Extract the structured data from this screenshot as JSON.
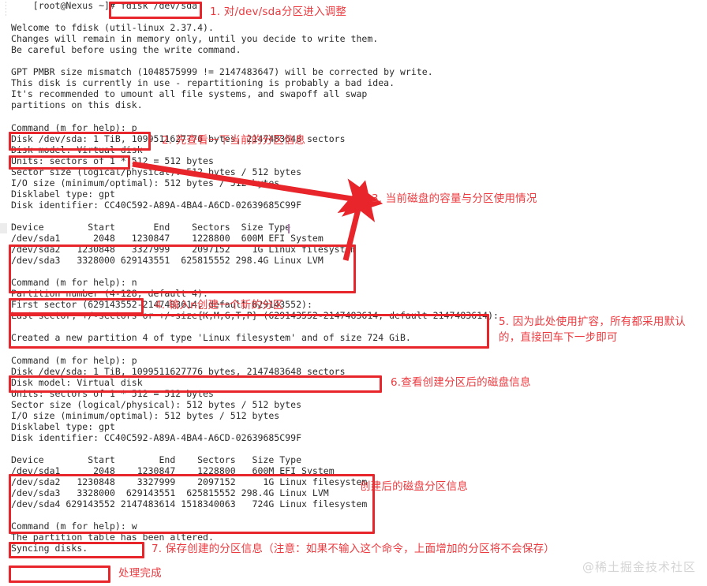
{
  "terminal": {
    "lines": [
      "    [root@Nexus ~]# fdisk /dev/sda",
      "",
      "Welcome to fdisk (util-linux 2.37.4).",
      "Changes will remain in memory only, until you decide to write them.",
      "Be careful before using the write command.",
      "",
      "GPT PMBR size mismatch (1048575999 != 2147483647) will be corrected by write.",
      "This disk is currently in use - repartitioning is probably a bad idea.",
      "It's recommended to umount all file systems, and swapoff all swap",
      "partitions on this disk.",
      "",
      "Command (m for help): p",
      "Disk /dev/sda: 1 TiB, 1099511627776 bytes, 2147483648 sectors",
      "Disk model: Virtual disk",
      "Units: sectors of 1 * 512 = 512 bytes",
      "Sector size (logical/physical): 512 bytes / 512 bytes",
      "I/O size (minimum/optimal): 512 bytes / 512 bytes",
      "Disklabel type: gpt",
      "Disk identifier: CC40C592-A89A-4BA4-A6CD-02639685C99F",
      "",
      "Device        Start       End    Sectors  Size Type",
      "/dev/sda1      2048   1230847    1228800  600M EFI System",
      "/dev/sda2   1230848   3327999    2097152    1G Linux filesystem",
      "/dev/sda3   3328000 629143551  625815552 298.4G Linux LVM",
      "",
      "Command (m for help): n",
      "Partition number (4-128, default 4):",
      "First sector (629143552-2147483614, default 629143552):",
      "Last sector, +/-sectors or +/-size{K,M,G,T,P} (629143552-2147483614, default 2147483614):",
      "",
      "Created a new partition 4 of type 'Linux filesystem' and of size 724 GiB.",
      "",
      "Command (m for help): p",
      "Disk /dev/sda: 1 TiB, 1099511627776 bytes, 2147483648 sectors",
      "Disk model: Virtual disk",
      "Units: sectors of 1 * 512 = 512 bytes",
      "Sector size (logical/physical): 512 bytes / 512 bytes",
      "I/O size (minimum/optimal): 512 bytes / 512 bytes",
      "Disklabel type: gpt",
      "Disk identifier: CC40C592-A89A-4BA4-A6CD-02639685C99F",
      "",
      "Device        Start        End    Sectors   Size Type",
      "/dev/sda1      2048    1230847    1228800   600M EFI System",
      "/dev/sda2   1230848    3327999    2097152     1G Linux filesystem",
      "/dev/sda3   3328000  629143551  625815552 298.4G Linux LVM",
      "/dev/sda4 629143552 2147483614 1518340063   724G Linux filesystem",
      "",
      "Command (m for help): w",
      "The partition table has been altered.",
      "Syncing disks."
    ]
  },
  "partition_table_first": {
    "headers": [
      "Device",
      "Start",
      "End",
      "Sectors",
      "Size",
      "Type"
    ],
    "rows": [
      [
        "/dev/sda1",
        "2048",
        "1230847",
        "1228800",
        "600M",
        "EFI System"
      ],
      [
        "/dev/sda2",
        "1230848",
        "3327999",
        "2097152",
        "1G",
        "Linux filesystem"
      ],
      [
        "/dev/sda3",
        "3328000",
        "629143551",
        "625815552",
        "298.4G",
        "Linux LVM"
      ]
    ]
  },
  "partition_table_second": {
    "headers": [
      "Device",
      "Start",
      "End",
      "Sectors",
      "Size",
      "Type"
    ],
    "rows": [
      [
        "/dev/sda1",
        "2048",
        "1230847",
        "1228800",
        "600M",
        "EFI System"
      ],
      [
        "/dev/sda2",
        "1230848",
        "3327999",
        "2097152",
        "1G",
        "Linux filesystem"
      ],
      [
        "/dev/sda3",
        "3328000",
        "629143551",
        "625815552",
        "298.4G",
        "Linux LVM"
      ],
      [
        "/dev/sda4",
        "629143552",
        "2147483614",
        "1518340063",
        "724G",
        "Linux filesystem"
      ]
    ]
  },
  "annotations": [
    {
      "id": "1",
      "text": "1. 对/dev/sda分区进入调整"
    },
    {
      "id": "2",
      "text": "2. 先查看一下当前的分区信息"
    },
    {
      "id": "3",
      "text": "3. 当前磁盘的容量与分区使用情况"
    },
    {
      "id": "4",
      "text": "4. 输入n创建一个新的分区"
    },
    {
      "id": "5",
      "text": "5. 因为此处使用扩容，所有都采用默认\n的，直接回车下一步即可"
    },
    {
      "id": "6",
      "text": "6.查看创建分区后的磁盘信息"
    },
    {
      "id": "7",
      "text": "创建后的磁盘分区信息"
    },
    {
      "id": "8",
      "text": "7. 保存创建的分区信息（注意：如果不输入这个命令，上面增加的分区将不会保存）"
    },
    {
      "id": "9",
      "text": "处理完成"
    }
  ],
  "watermark": {
    "text": "@稀土掘金技术社区"
  },
  "colors": {
    "highlight_border": "#e8252a",
    "annotation_text": "#ec3b40",
    "terminal_text": "#2b2b2b",
    "background": "#ffffff",
    "watermark": "#d4d4d4",
    "caret": "#b07ab0"
  }
}
